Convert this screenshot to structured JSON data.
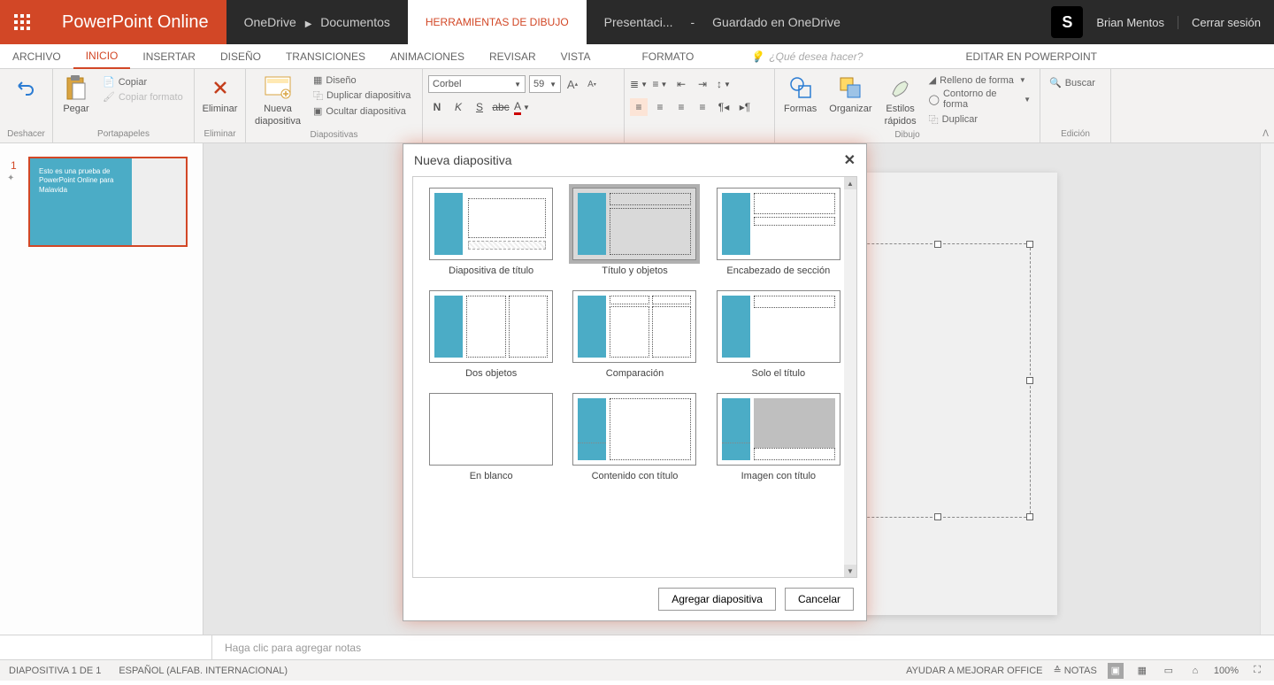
{
  "titlebar": {
    "app": "PowerPoint Online",
    "crumb1": "OneDrive",
    "crumb2": "Documentos",
    "tool_context": "HERRAMIENTAS DE DIBUJO",
    "doc": "Presentaci...",
    "dash": "-",
    "saved": "Guardado en OneDrive",
    "user": "Brian Mentos",
    "signout": "Cerrar sesión"
  },
  "tabs": {
    "archivo": "ARCHIVO",
    "inicio": "INICIO",
    "insertar": "INSERTAR",
    "diseno": "DISEÑO",
    "transiciones": "TRANSICIONES",
    "animaciones": "ANIMACIONES",
    "revisar": "REVISAR",
    "vista": "VISTA",
    "formato": "FORMATO",
    "tellme": "¿Qué desea hacer?",
    "edit": "EDITAR EN POWERPOINT"
  },
  "ribbon": {
    "deshacer": "Deshacer",
    "pegar": "Pegar",
    "copiar": "Copiar",
    "copiar_formato": "Copiar formato",
    "portapapeles": "Portapapeles",
    "eliminar": "Eliminar",
    "eliminar_grp": "Eliminar",
    "nueva": "Nueva",
    "diapositiva": "diapositiva",
    "diseno": "Diseño",
    "duplicar_diap": "Duplicar diapositiva",
    "ocultar_diap": "Ocultar diapositiva",
    "diapositivas": "Diapositivas",
    "font_name": "Corbel",
    "font_size": "59",
    "formas": "Formas",
    "organizar": "Organizar",
    "estilos": "Estilos",
    "rapidos": "rápidos",
    "relleno": "Relleno de forma",
    "contorno": "Contorno de forma",
    "duplicar": "Duplicar",
    "dibujo": "Dibujo",
    "buscar": "Buscar",
    "edicion": "Edición"
  },
  "thumb_text": "Esto es una prueba de PowerPoint Online para Malavida",
  "modal": {
    "title": "Nueva diapositiva",
    "close": "✕",
    "layouts": [
      "Diapositiva de título",
      "Título y objetos",
      "Encabezado de sección",
      "Dos objetos",
      "Comparación",
      "Solo el título",
      "En blanco",
      "Contenido con título",
      "Imagen con título"
    ],
    "add": "Agregar diapositiva",
    "cancel": "Cancelar"
  },
  "notes": "Haga clic para agregar notas",
  "status": {
    "slide": "DIAPOSITIVA 1 DE 1",
    "lang": "ESPAÑOL (ALFAB. INTERNACIONAL)",
    "improve": "AYUDAR A MEJORAR OFFICE",
    "notas": "NOTAS",
    "zoom": "100%"
  }
}
